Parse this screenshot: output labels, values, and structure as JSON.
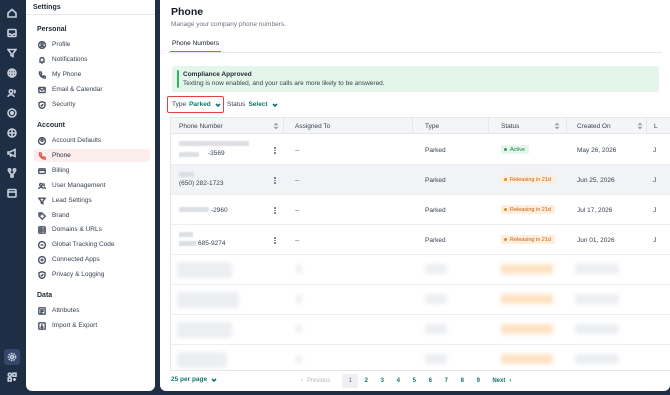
{
  "rail": {
    "icons": [
      "home-icon",
      "inbox-icon",
      "filter-icon",
      "globe-icon",
      "contacts-icon",
      "circle-dot-icon",
      "grid-icon",
      "megaphone-icon",
      "branch-icon",
      "calendar-icon"
    ],
    "bottom_icons": [
      "settings-icon",
      "apps-icon"
    ]
  },
  "settings": {
    "title": "Settings",
    "sections": [
      {
        "heading": "Personal",
        "items": [
          "Profile",
          "Notifications",
          "My Phone",
          "Email & Calendar",
          "Security"
        ]
      },
      {
        "heading": "Account",
        "items": [
          "Account Defaults",
          "Phone",
          "Billing",
          "User Management",
          "Lead Settings",
          "Brand",
          "Domains & URLs",
          "Global Tracking Code",
          "Connected Apps",
          "Privacy & Logging"
        ]
      },
      {
        "heading": "Data",
        "items": [
          "Attributes",
          "Import & Export"
        ]
      }
    ],
    "active_item": "Phone"
  },
  "main": {
    "title": "Phone",
    "subtitle": "Manage your company phone numbers.",
    "tab": "Phone Numbers",
    "banner": {
      "title": "Compliance Approved",
      "text": "Texting is now enabled, and your calls are more likely to be answered."
    },
    "filters": {
      "type_label": "Type",
      "type_value": "Parked",
      "status_label": "Status",
      "status_value": "Select"
    },
    "columns": [
      "Phone Number",
      "Assigned To",
      "Type",
      "Status",
      "Created On",
      "L"
    ],
    "rows": [
      {
        "phone": "-3569",
        "assigned": "--",
        "type": "Parked",
        "status": "Active",
        "created": "May 26, 2026",
        "last": "J"
      },
      {
        "phone": "(650) 282-1723",
        "assigned": "--",
        "type": "Parked",
        "status": "Releasing in 21d",
        "created": "Jun 25, 2026",
        "last": "J"
      },
      {
        "phone": "-2960",
        "assigned": "--",
        "type": "Parked",
        "status": "Releasing in 21d",
        "created": "Jul 17, 2026",
        "last": "J"
      },
      {
        "phone": "685-9274",
        "assigned": "--",
        "type": "Parked",
        "status": "Releasing in 21d",
        "created": "Jun 01, 2026",
        "last": "J"
      }
    ],
    "pagination": {
      "per_page": "25 per page",
      "prev": "Previous",
      "pages": [
        "1",
        "2",
        "3",
        "4",
        "5",
        "6",
        "7",
        "8",
        "9"
      ],
      "current": "1",
      "next": "Next"
    }
  }
}
